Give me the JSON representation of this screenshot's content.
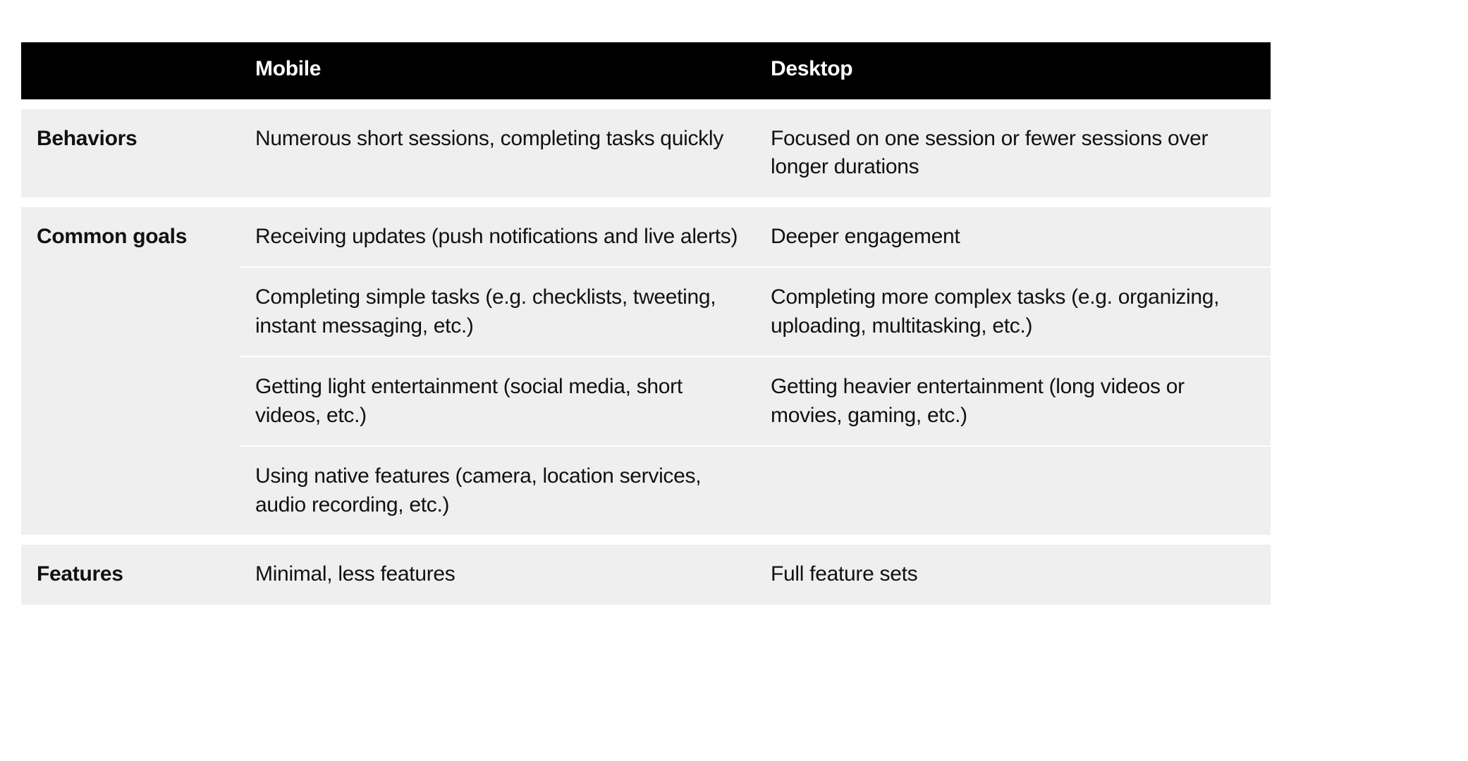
{
  "columns": {
    "mobile": "Mobile",
    "desktop": "Desktop"
  },
  "rows": {
    "behaviors": {
      "label": "Behaviors",
      "mobile": "Numerous short sessions, completing tasks quickly",
      "desktop": "Focused on one session or fewer sessions over longer durations"
    },
    "common_goals": {
      "label": "Common goals",
      "items": [
        {
          "mobile": "Receiving updates (push notifications and live alerts)",
          "desktop": "Deeper engagement"
        },
        {
          "mobile": "Completing simple tasks (e.g. checklists, tweeting, instant messaging, etc.)",
          "desktop": "Completing more complex tasks (e.g. organizing, uploading, multitasking, etc.)"
        },
        {
          "mobile": "Getting light entertainment (social media, short videos, etc.)",
          "desktop": "Getting heavier entertainment (long videos or movies, gaming, etc.)"
        },
        {
          "mobile": "Using native features (camera, location services, audio recording, etc.)",
          "desktop": ""
        }
      ]
    },
    "features": {
      "label": "Features",
      "mobile": "Minimal, less features",
      "desktop": "Full feature sets"
    }
  }
}
